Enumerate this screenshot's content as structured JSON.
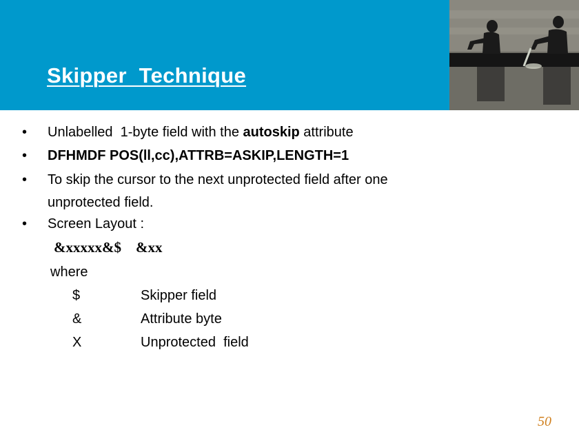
{
  "slide": {
    "title": "Skipper  Technique",
    "header_color": "#0099cc",
    "header_image": "rowers-silhouette-photo",
    "bullets": [
      {
        "marker": "•",
        "parts": [
          {
            "text": "Unlabelled  1-byte field with the ",
            "bold": false
          },
          {
            "text": "autoskip",
            "bold": true
          },
          {
            "text": " attribute",
            "bold": false
          }
        ]
      },
      {
        "marker": "•",
        "text": "DFHMDF POS(ll,cc),ATTRB=ASKIP,LENGTH=1"
      },
      {
        "marker": "•",
        "line1": "To skip the cursor to the next unprotected field after one",
        "line2": "unprotected field."
      },
      {
        "marker": "•",
        "text": "Screen Layout :"
      }
    ],
    "layout_example": "&xxxxx&$    &xx",
    "where_label": "where",
    "legend": [
      {
        "symbol": "$",
        "meaning": "Skipper field"
      },
      {
        "symbol": "&",
        "meaning": "Attribute byte"
      },
      {
        "symbol": "X",
        "meaning": "Unprotected  field"
      }
    ],
    "page_number": "50",
    "page_number_color": "#d0801f"
  }
}
